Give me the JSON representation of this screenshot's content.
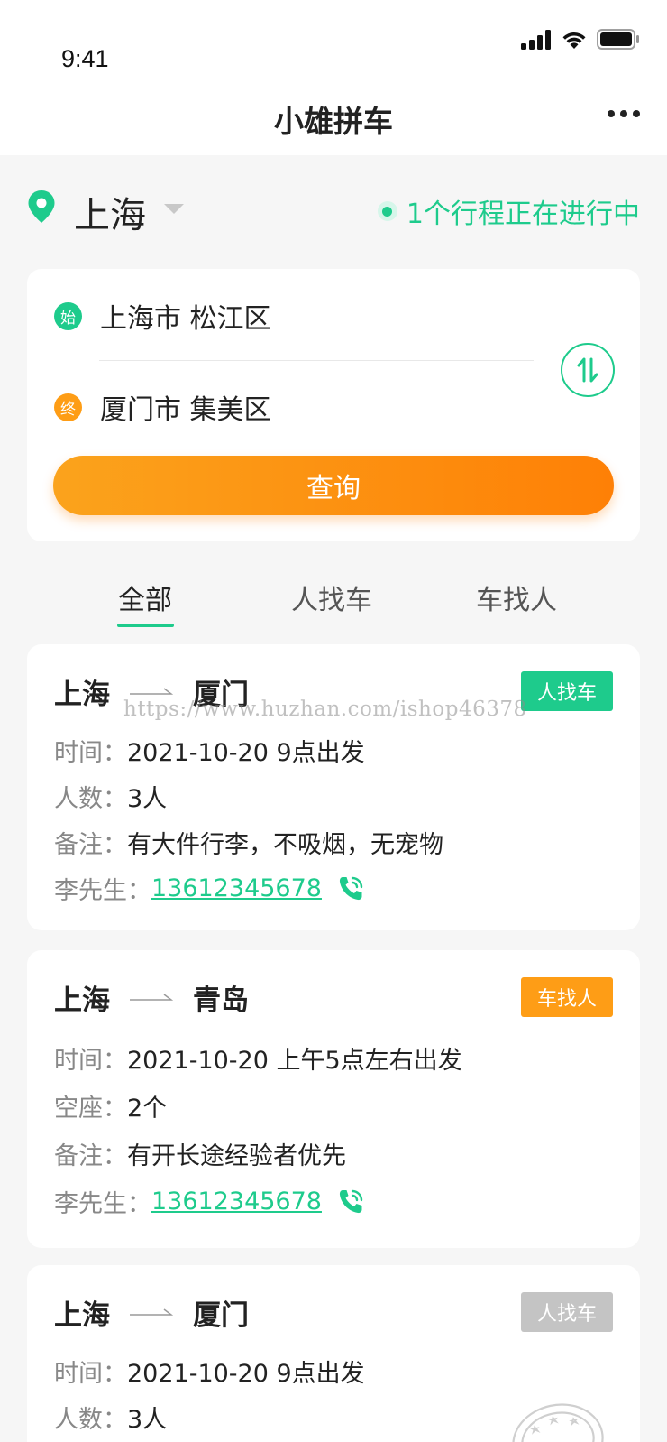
{
  "status_bar": {
    "time": "9:41"
  },
  "header": {
    "title": "小雄拼车"
  },
  "location": {
    "city": "上海",
    "trip_status": "1个行程正在进行中"
  },
  "search": {
    "start_badge": "始",
    "start_location": "上海市 松江区",
    "end_badge": "终",
    "end_location": "厦门市 集美区",
    "query_label": "查询"
  },
  "tabs": [
    {
      "label": "全部",
      "active": true
    },
    {
      "label": "人找车",
      "active": false
    },
    {
      "label": "车找人",
      "active": false
    }
  ],
  "watermark": "https://www.huzhan.com/ishop46378",
  "listings": [
    {
      "from": "上海",
      "to": "厦门",
      "tag": "人找车",
      "tag_color": "#1ecb8c",
      "rows": [
        {
          "label": "时间：",
          "value": "2021-10-20 9点出发"
        },
        {
          "label": "人数：",
          "value": "3人"
        },
        {
          "label": "备注：",
          "value": "有大件行李，不吸烟，无宠物"
        }
      ],
      "contact_label": "李先生：",
      "phone": "13612345678"
    },
    {
      "from": "上海",
      "to": "青岛",
      "tag": "车找人",
      "tag_color": "#fe9d16",
      "rows": [
        {
          "label": "时间：",
          "value": "2021-10-20 上午5点左右出发"
        },
        {
          "label": "空座：",
          "value": "2个"
        },
        {
          "label": "备注：",
          "value": "有开长途经验者优先"
        }
      ],
      "contact_label": "李先生：",
      "phone": "13612345678"
    },
    {
      "from": "上海",
      "to": "厦门",
      "tag": "人找车",
      "tag_color": "#c4c4c4",
      "rows": [
        {
          "label": "时间：",
          "value": "2021-10-20 9点出发"
        },
        {
          "label": "人数：",
          "value": "3人"
        }
      ]
    }
  ],
  "colors": {
    "accent": "#1ecb8c",
    "orange": "#fe8006",
    "background": "#f6f6f6"
  }
}
